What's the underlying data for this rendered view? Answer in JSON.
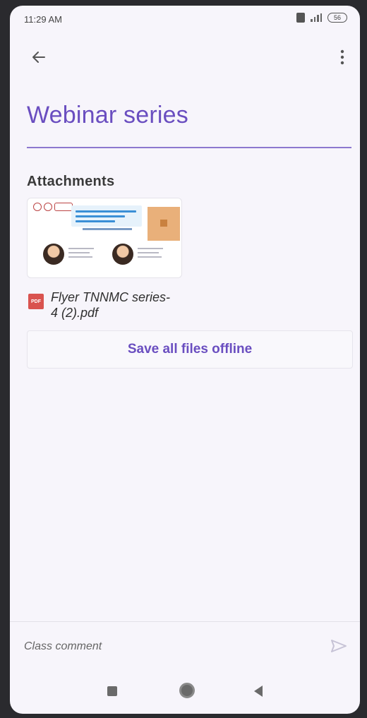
{
  "status_bar": {
    "time": "11:29 AM",
    "battery": "56"
  },
  "header": {
    "back_icon": "arrow-left-icon",
    "more_icon": "more-vertical-icon",
    "title": "Webinar series"
  },
  "attachments": {
    "heading": "Attachments",
    "items": [
      {
        "file_icon": "pdf-icon",
        "file_badge": "PDF",
        "name": "Flyer TNNMC series-4 (2).pdf"
      }
    ]
  },
  "actions": {
    "save_offline_label": "Save all files offline"
  },
  "comment_bar": {
    "placeholder": "Class comment",
    "send_icon": "send-icon"
  },
  "nav_bar": {
    "recents_icon": "recents-square-icon",
    "home_icon": "home-circle-icon",
    "back_icon": "back-triangle-icon"
  },
  "colors": {
    "accent": "#6a4ec0",
    "background": "#f7f5fb",
    "pdf_red": "#d9534f"
  }
}
